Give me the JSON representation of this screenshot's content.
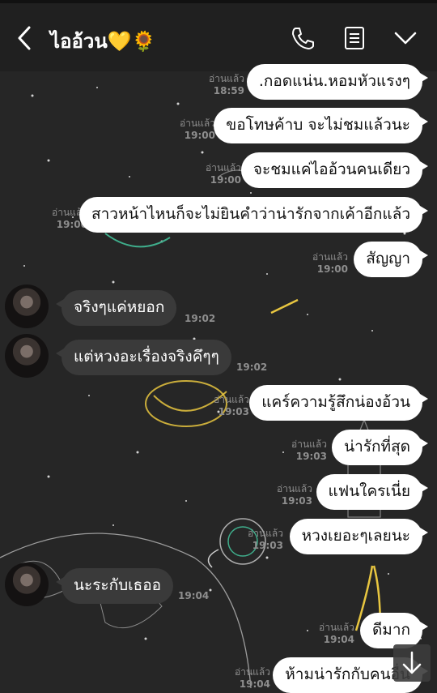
{
  "header": {
    "title": "ไออ้วน💛🌻",
    "icons": {
      "back": "chevron-left-icon",
      "call": "phone-icon",
      "notes": "notes-icon",
      "menu": "chevron-down-icon"
    }
  },
  "messages": [
    {
      "dir": "out",
      "text": ".กอดแน่น.หอมหัวแรงๆ",
      "read": "อ่านแล้ว",
      "time": "18:59"
    },
    {
      "dir": "out",
      "text": "ขอโทษค้าบ จะไม่ชมแล้วนะ",
      "read": "อ่านแล้ว",
      "time": "19:00"
    },
    {
      "dir": "out",
      "text": "จะชมแค่ไออ้วนคนเดียว",
      "read": "อ่านแล้ว",
      "time": "19:00"
    },
    {
      "dir": "out",
      "text": "สาวหน้าไหนก็จะไม่ยินคำว่าน่ารักจากเค้าอีกแล้ว",
      "read": "อ่านแล้ว",
      "time": "19:00"
    },
    {
      "dir": "out",
      "text": "สัญญา",
      "read": "อ่านแล้ว",
      "time": "19:00"
    },
    {
      "dir": "in",
      "text": "จริงๆแค่หยอก",
      "time": "19:02"
    },
    {
      "dir": "in",
      "text": "แต่หวงอะเรื่องจริงคึๆๆ",
      "time": "19:02"
    },
    {
      "dir": "out",
      "text": "แคร์ความรู้สึกน่องอ้วน",
      "read": "อ่านแล้ว",
      "time": "19:03"
    },
    {
      "dir": "out",
      "text": "น่ารักที่สุด",
      "read": "อ่านแล้ว",
      "time": "19:03"
    },
    {
      "dir": "out",
      "text": "แฟนใครเนี่ย",
      "read": "อ่านแล้ว",
      "time": "19:03"
    },
    {
      "dir": "out",
      "text": "หวงเยอะๆเลยนะ",
      "read": "อ่านแล้ว",
      "time": "19:03"
    },
    {
      "dir": "in",
      "text": "นะระกับเธออ",
      "time": "19:04"
    },
    {
      "dir": "out",
      "text": "ดีมาก",
      "read": "อ่านแล้ว",
      "time": "19:04"
    },
    {
      "dir": "out",
      "text": "ห้ามน่ารักกับคนอื่น",
      "read": "อ่านแล้ว",
      "time": "19:04"
    }
  ],
  "scroll_down_icon": "arrow-down-icon",
  "colors": {
    "background": "#262626",
    "header": "#202020",
    "outgoing_bubble": "#ffffff",
    "incoming_bubble": "#3a3a3a",
    "meta_text": "#8e8e8e"
  }
}
